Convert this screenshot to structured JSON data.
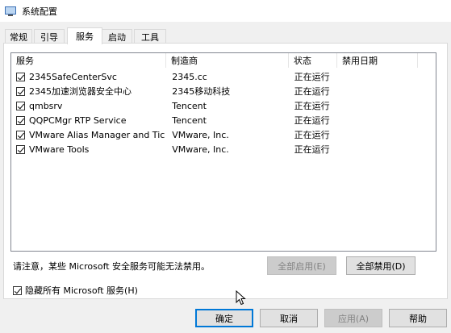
{
  "window": {
    "title": "系统配置"
  },
  "tabs": [
    {
      "label": "常规"
    },
    {
      "label": "引导"
    },
    {
      "label": "服务"
    },
    {
      "label": "启动"
    },
    {
      "label": "工具"
    }
  ],
  "list": {
    "columns": [
      "服务",
      "制造商",
      "状态",
      "禁用日期"
    ],
    "rows": [
      {
        "name": "2345SafeCenterSvc",
        "maker": "2345.cc",
        "status": "正在运行",
        "date": "",
        "checked": true
      },
      {
        "name": "2345加速浏览器安全中心",
        "maker": "2345移动科技",
        "status": "正在运行",
        "date": "",
        "checked": true
      },
      {
        "name": "qmbsrv",
        "maker": "Tencent",
        "status": "正在运行",
        "date": "",
        "checked": true
      },
      {
        "name": "QQPCMgr RTP Service",
        "maker": "Tencent",
        "status": "正在运行",
        "date": "",
        "checked": true
      },
      {
        "name": "VMware Alias Manager and Tick...",
        "maker": "VMware, Inc.",
        "status": "正在运行",
        "date": "",
        "checked": true
      },
      {
        "name": "VMware Tools",
        "maker": "VMware, Inc.",
        "status": "正在运行",
        "date": "",
        "checked": true
      }
    ]
  },
  "note": "请注意，某些 Microsoft 安全服务可能无法禁用。",
  "buttons": {
    "enable_all": "全部启用(E)",
    "disable_all": "全部禁用(D)",
    "ok": "确定",
    "cancel": "取消",
    "apply": "应用(A)",
    "help": "帮助"
  },
  "hide_ms": {
    "label": "隐藏所有 Microsoft 服务(H)",
    "checked": true
  },
  "colors": {
    "accent": "#0078d7",
    "panel_bg": "#ffffff",
    "window_bg": "#f0f0f0"
  }
}
